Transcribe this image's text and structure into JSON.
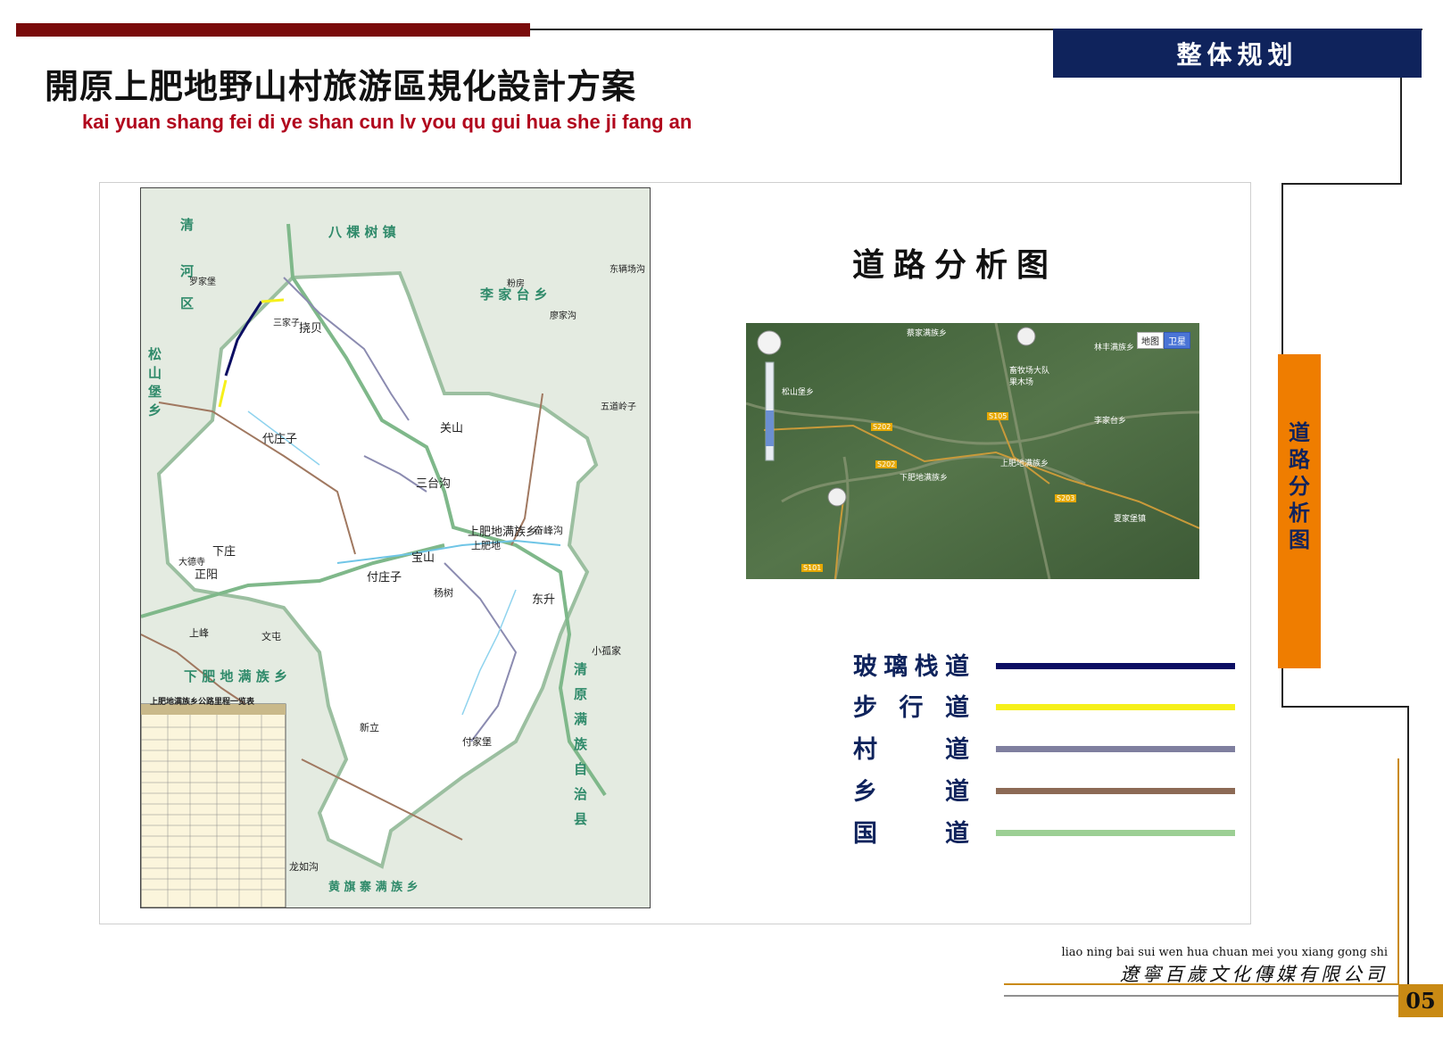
{
  "header": {
    "section_tab": "整体规划",
    "title": "開原上肥地野山村旅游區規化設計方案",
    "subtitle": "kai yuan shang fei di ye shan cun lv you qu gui hua she ji fang an"
  },
  "main": {
    "heading": "道路分析图",
    "map_labels": [
      "八 棵 树 镇",
      "李 家 台 乡",
      "清",
      "河",
      "区",
      "松",
      "山",
      "堡",
      "乡",
      "挠贝",
      "代庄子",
      "关山",
      "三台沟",
      "上肥地满族乡",
      "上肥地",
      "奋峰沟",
      "宝山",
      "付庄子",
      "杨树",
      "东升",
      "正阳",
      "下庄",
      "上峰",
      "文屯",
      "下 肥 地 满 族 乡",
      "小孤家",
      "清",
      "原",
      "满",
      "族",
      "自",
      "治",
      "县",
      "付家堡",
      "新立",
      "龙如沟",
      "黄 旗 寨 满 族 乡",
      "罗家堡",
      "五道岭子",
      "东辆场沟",
      "粉房",
      "廖家沟",
      "三家子",
      "大德寺"
    ],
    "map_table": {
      "title": "上肥地满族乡公路里程一览表"
    },
    "satellite": {
      "toggle_map": "地图",
      "toggle_sat": "卫星",
      "labels": [
        "蔡家满族乡",
        "林丰满族乡",
        "畜牧场大队果木场",
        "松山堡乡",
        "李家台乡",
        "上肥地满族乡",
        "下肥地满族乡",
        "夏家堡镇"
      ],
      "road_tags": [
        "S202",
        "S105",
        "S202",
        "S203",
        "S101"
      ]
    },
    "legend": [
      {
        "label": "玻璃栈道",
        "color": "#0c0e63"
      },
      {
        "label": "步行道",
        "color": "#f6f01a"
      },
      {
        "label": "村道",
        "color": "#7f7f9f"
      },
      {
        "label": "乡道",
        "color": "#8c6a55"
      },
      {
        "label": "国道",
        "color": "#9ccf94"
      }
    ]
  },
  "side": {
    "label": "道路分析图"
  },
  "footer": {
    "company_pinyin": "liao ning bai sui wen hua chuan mei you xiang gong shi",
    "company_cn": "遼寧百歲文化傳媒有限公司",
    "page_number": "05"
  }
}
